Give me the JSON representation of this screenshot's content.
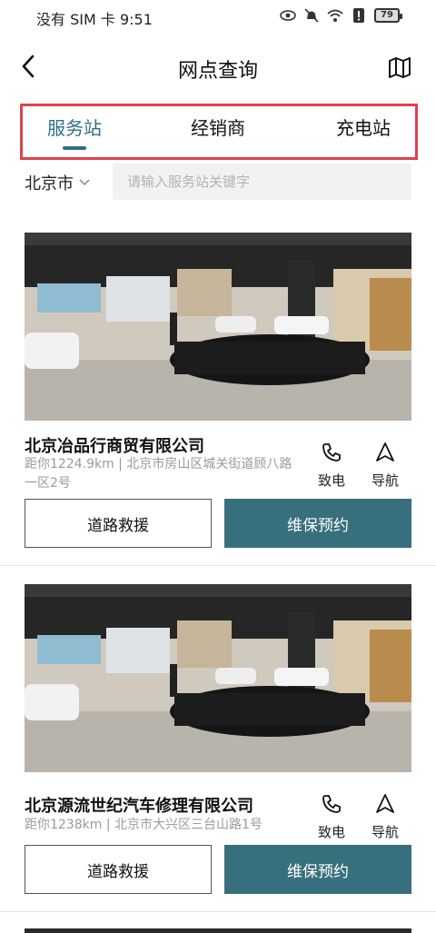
{
  "status_bar": {
    "carrier_time": "没有 SIM 卡 9:51",
    "battery": "79"
  },
  "header": {
    "title": "网点查询"
  },
  "tabs": [
    {
      "label": "服务站",
      "active": true
    },
    {
      "label": "经销商",
      "active": false
    },
    {
      "label": "充电站",
      "active": false
    }
  ],
  "filter": {
    "city": "北京市",
    "search_placeholder": "请输入服务站关键字"
  },
  "stations": [
    {
      "name": "北京冶品行商贸有限公司",
      "address": "距你1224.9km | 北京市房山区城关街道顾八路一区2号",
      "call_label": "致电",
      "nav_label": "导航",
      "rescue_label": "道路救援",
      "maintenance_label": "维保预约"
    },
    {
      "name": "北京源流世纪汽车修理有限公司",
      "address": "距你1238km | 北京市大兴区三台山路1号",
      "call_label": "致电",
      "nav_label": "导航",
      "rescue_label": "道路救援",
      "maintenance_label": "维保预约"
    }
  ],
  "colors": {
    "accent": "#2f6f86",
    "button_fill": "#386f7c",
    "highlight_border": "#e0414d"
  }
}
